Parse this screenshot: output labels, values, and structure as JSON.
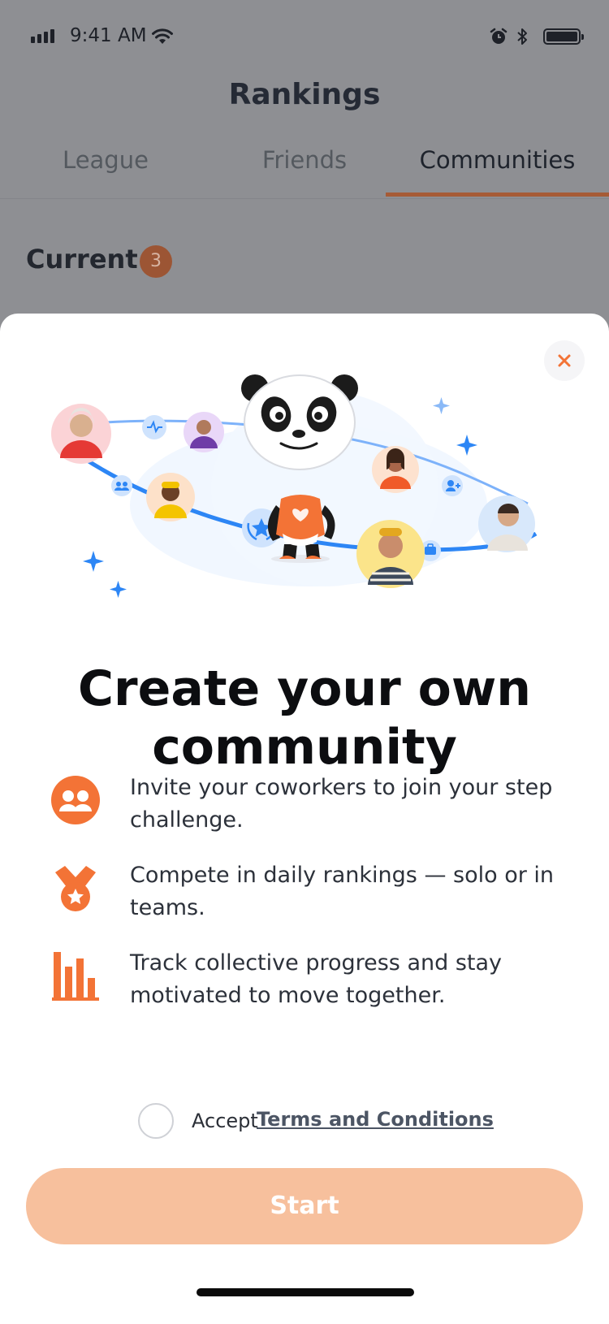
{
  "status_bar": {
    "time": "9:41 AM"
  },
  "header": {
    "title": "Rankings",
    "tabs": [
      {
        "label": "League",
        "active": false
      },
      {
        "label": "Friends",
        "active": false
      },
      {
        "label": "Communities",
        "active": true
      }
    ]
  },
  "section": {
    "label": "Current",
    "count": "3"
  },
  "sheet": {
    "close_icon": "close-icon",
    "headline": "Create your own community",
    "benefits": [
      {
        "icon": "people-icon",
        "text": "Invite your coworkers to join your step challenge."
      },
      {
        "icon": "medal-icon",
        "text": "Compete in daily rankings — solo or in teams."
      },
      {
        "icon": "bar-chart-icon",
        "text": "Track collective progress and stay motivated to move together."
      }
    ],
    "terms": {
      "accept_text": "Accept",
      "link_text": "Terms and Conditions",
      "checked": false
    },
    "start_button": "Start"
  },
  "colors": {
    "accent": "#f37336",
    "button_disabled": "#f7c09d",
    "tab_indicator": "#a65b36",
    "orbit_blue": "#2d86f5"
  }
}
